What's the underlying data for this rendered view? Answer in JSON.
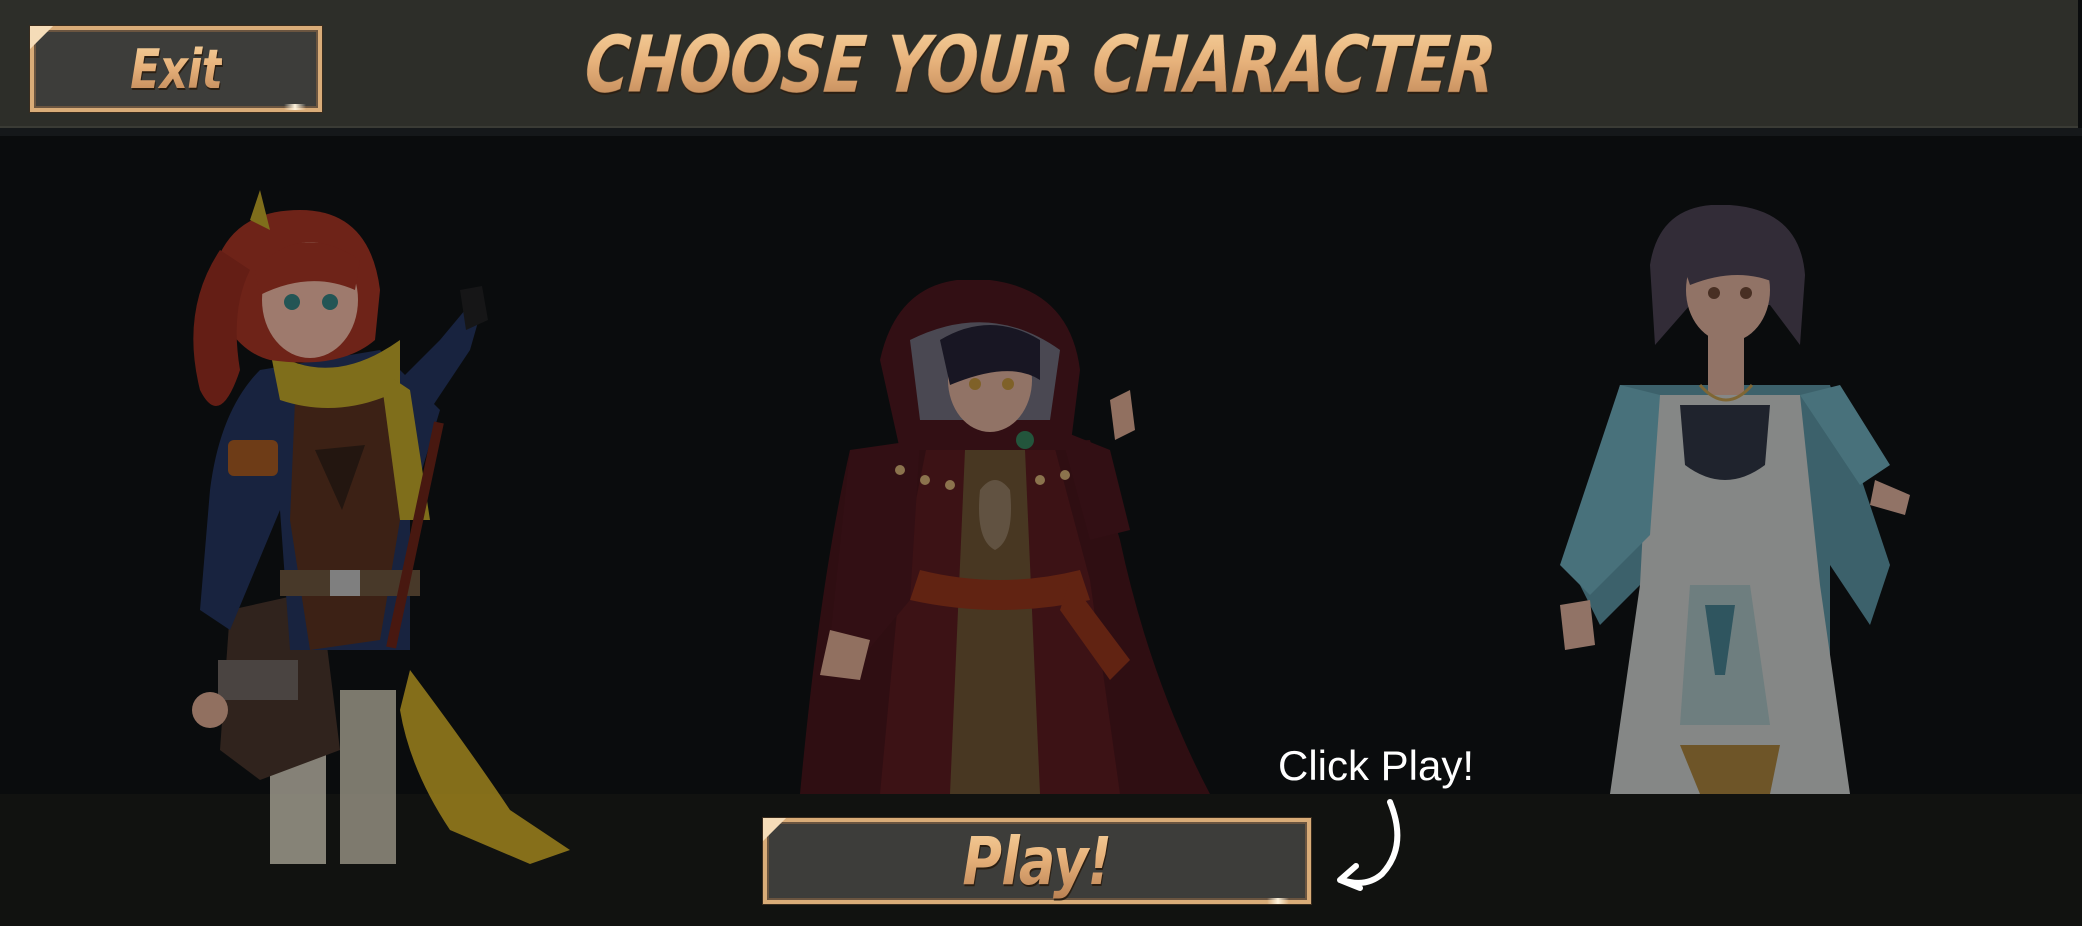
{
  "header": {
    "exit_label": "Exit",
    "title": "CHOOSE YOUR CHARACTER"
  },
  "characters": [
    {
      "id": "warrior",
      "name": "red-haired-adventurer"
    },
    {
      "id": "mage",
      "name": "hooded-mage"
    },
    {
      "id": "priest",
      "name": "white-robed-priestess"
    }
  ],
  "footer": {
    "hint_text": "Click Play!",
    "play_label": "Play!"
  },
  "colors": {
    "gold": "#e1b07a",
    "gold_light": "#f7d39e",
    "button_fill": "#3d3d3a",
    "header_bg": "#2d2e29",
    "stage_bg": "#0a0c0d",
    "hint_text": "#ffffff"
  }
}
